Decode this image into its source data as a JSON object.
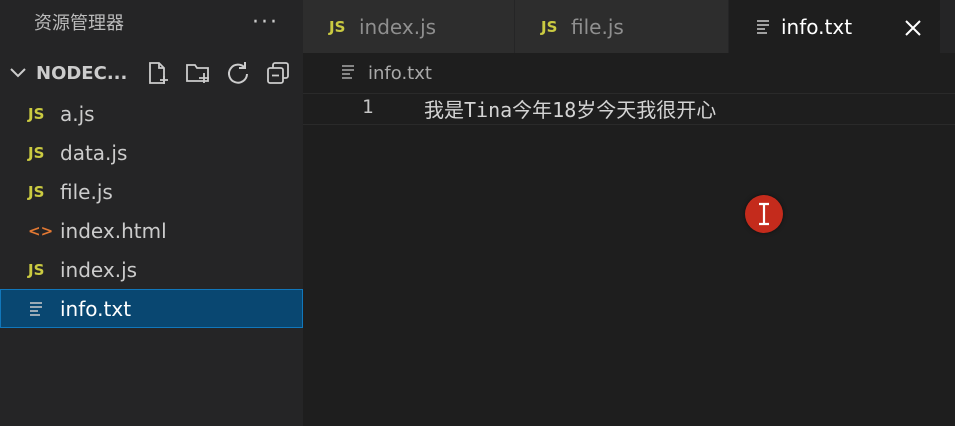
{
  "sidebar": {
    "title": "资源管理器",
    "more_label": "···",
    "folder_name": "NODEC...",
    "files": [
      {
        "name": "a.js",
        "type": "js"
      },
      {
        "name": "data.js",
        "type": "js"
      },
      {
        "name": "file.js",
        "type": "js"
      },
      {
        "name": "index.html",
        "type": "html"
      },
      {
        "name": "index.js",
        "type": "js"
      },
      {
        "name": "info.txt",
        "type": "txt",
        "active": true
      }
    ]
  },
  "icons": {
    "js_label": "JS",
    "html_label": "<>"
  },
  "tabs": [
    {
      "label": "index.js",
      "type": "js",
      "active": false
    },
    {
      "label": "file.js",
      "type": "js",
      "active": false
    },
    {
      "label": "info.txt",
      "type": "txt",
      "active": true
    }
  ],
  "editor": {
    "breadcrumb": "info.txt",
    "line_number": "1",
    "line_text": "我是Tina今年18岁今天我很开心"
  },
  "colors": {
    "js_icon": "#cbcb41",
    "html_icon": "#e37933",
    "selection": "#094771",
    "cursor_marker": "#c42b1c"
  }
}
